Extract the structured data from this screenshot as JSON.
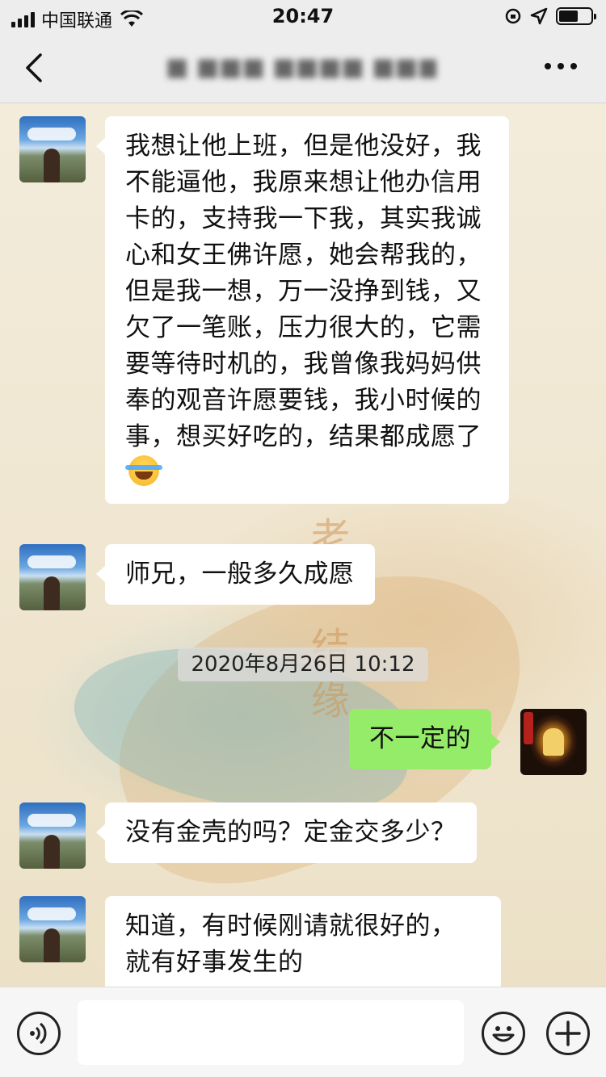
{
  "status_bar": {
    "carrier": "中国联通",
    "time": "20:47"
  },
  "nav": {
    "title": "■ ■■■ ■■■■ ■■■■■■"
  },
  "messages": [
    {
      "from": "friend",
      "text": "我想让他上班，但是他没好，我不能逼他，我原来想让他办信用卡的，支持我一下我，其实我诚心和女王佛许愿，她会帮我的，但是我一想，万一没挣到钱，又欠了一笔账，压力很大的，它需要等待时机的，我曾像我妈妈供奉的观音许愿要钱，我小时候的事，想买好吃的，结果都成愿了",
      "emoji": "face-with-tears-of-joy"
    },
    {
      "from": "friend",
      "text": "师兄，一般多久成愿"
    },
    {
      "from": "me",
      "text": "不一定的"
    },
    {
      "from": "friend",
      "text": "没有金壳的吗？定金交多少？"
    },
    {
      "from": "friend",
      "text": "知道，有时候刚请就很好的，就有好事发生的"
    }
  ],
  "timestamp": "2020年8月26日 10:12",
  "wallpaper_chars": [
    "老",
    "结",
    "缘"
  ],
  "colors": {
    "bar_bg": "#ededed",
    "bubble_self": "#95ec69",
    "bubble_friend": "#ffffff"
  }
}
